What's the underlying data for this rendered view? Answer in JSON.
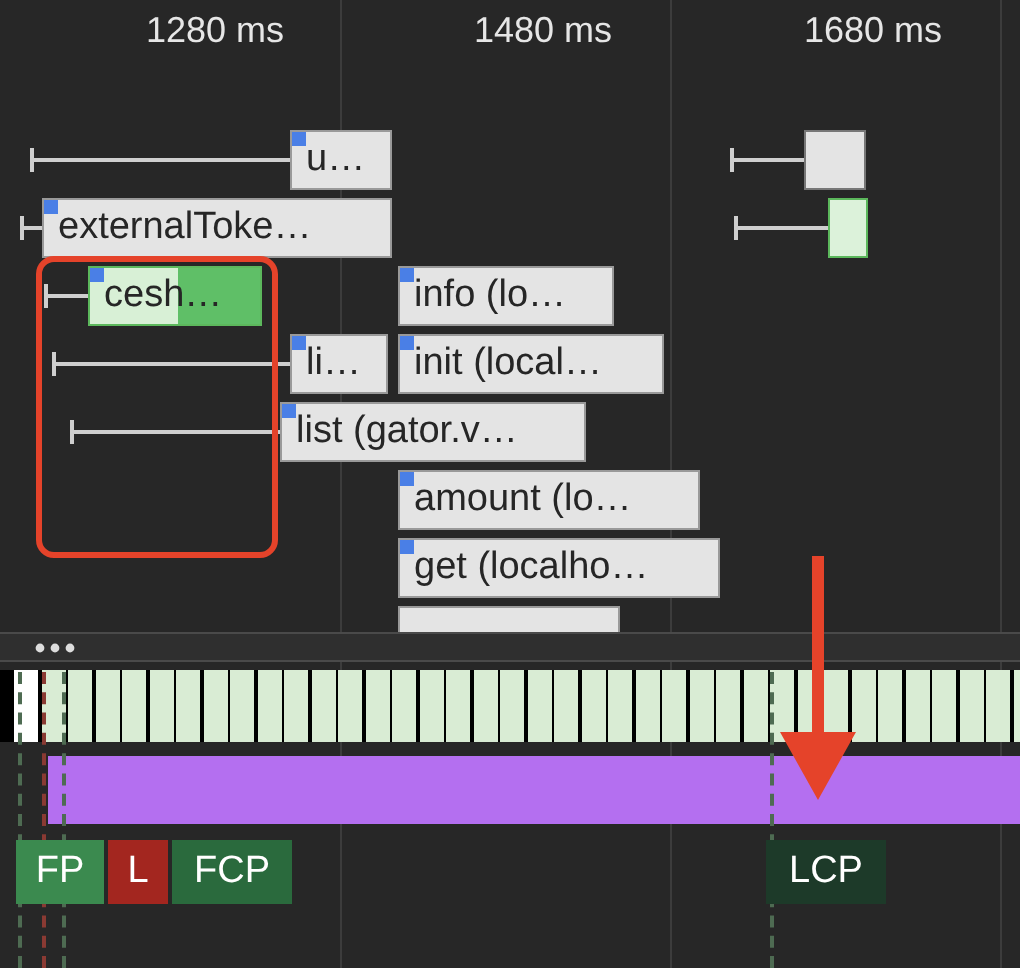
{
  "time_ruler": {
    "ticks": [
      "1280 ms",
      "1480 ms",
      "1680 ms"
    ]
  },
  "flame_chart": {
    "entries": [
      {
        "label": "u…",
        "kind": "plain"
      },
      {
        "label": "externalToke…",
        "kind": "plain"
      },
      {
        "label": "cesh…",
        "kind": "highlight"
      },
      {
        "label": "info (lo…",
        "kind": "plain"
      },
      {
        "label": "li…",
        "kind": "plain"
      },
      {
        "label": "init (local…",
        "kind": "plain"
      },
      {
        "label": "list (gator.v…",
        "kind": "plain"
      },
      {
        "label": "amount (lo…",
        "kind": "plain"
      },
      {
        "label": "get (localho…",
        "kind": "plain"
      }
    ]
  },
  "timings": [
    {
      "label": "FP",
      "color": "#3b8a4f"
    },
    {
      "label": "L",
      "color": "#a3261f"
    },
    {
      "label": "FCP",
      "color": "#2a6a3d"
    },
    {
      "label": "LCP",
      "color": "#1d3a29"
    }
  ]
}
